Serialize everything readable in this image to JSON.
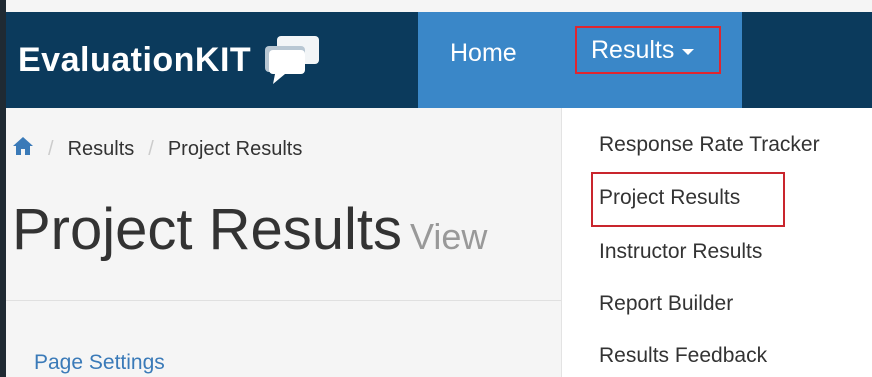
{
  "brand": {
    "name": "EvaluationKIT",
    "logo_icon": "speech-bubbles-icon"
  },
  "nav": {
    "home_label": "Home",
    "results_label": "Results"
  },
  "breadcrumb": {
    "home_icon": "home-icon",
    "items": [
      "Results",
      "Project Results"
    ],
    "separator": "/"
  },
  "page": {
    "title": "Project Results",
    "subtitle": "View",
    "settings_link": "Page Settings"
  },
  "results_menu": {
    "items": [
      "Response Rate Tracker",
      "Project Results",
      "Instructor Results",
      "Report Builder",
      "Results Feedback"
    ],
    "highlighted_item": "Project Results"
  },
  "colors": {
    "navbar": "#0b3a5c",
    "nav_active": "#3a87c8",
    "highlight_border": "#e0262f",
    "link": "#3a7ab8"
  }
}
